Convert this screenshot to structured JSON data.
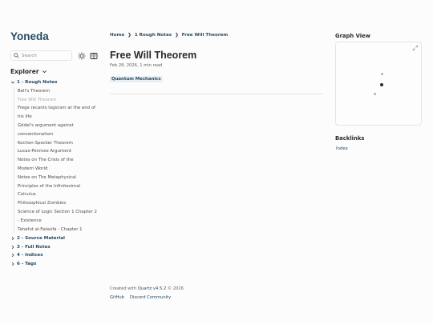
{
  "site": {
    "title": "Yoneda"
  },
  "search": {
    "placeholder": "Search"
  },
  "colors": {
    "accent": "#284b63",
    "muted": "#646464",
    "active_file": "#b3aa9f",
    "tag_bg": "#e9eff3"
  },
  "icons": {
    "search": "search-icon",
    "theme": "sun-icon",
    "reader": "book-icon",
    "chevron": "chevron-down-icon",
    "expand": "expand-icon"
  },
  "explorer": {
    "title": "Explorer",
    "folders": [
      {
        "label": "1 - Rough Notes",
        "expanded": true,
        "files": [
          {
            "label": "Bell's Theorem",
            "active": false
          },
          {
            "label": "Free Will Theorem",
            "active": true
          },
          {
            "label": "Frege recants logicism at the end of his life",
            "active": false
          },
          {
            "label": "Gödel's argument against conventionalism",
            "active": false
          },
          {
            "label": "Kochen-Specker Theorem",
            "active": false
          },
          {
            "label": "Lucas-Penrose Argument",
            "active": false
          },
          {
            "label": "Notes on The Crisis of the Modern World",
            "active": false
          },
          {
            "label": "Notes on The Metaphysical Principles of the Infinitesimal Calculus",
            "active": false
          },
          {
            "label": "Philosophical Zombies",
            "active": false
          },
          {
            "label": "Science of Logic Section 1 Chapter 2 - Existence",
            "active": false
          },
          {
            "label": "Tahafut al-Falasifa - Chapter 1",
            "active": false
          }
        ]
      },
      {
        "label": "2 - Source Material",
        "expanded": false
      },
      {
        "label": "3 - Full Notes",
        "expanded": false
      },
      {
        "label": "4 - Indices",
        "expanded": false
      },
      {
        "label": "6 - Tags",
        "expanded": false
      }
    ]
  },
  "breadcrumbs": [
    "Home",
    "1 Rough Notes",
    "Free Will Theorem"
  ],
  "breadcrumb_separator": "❯",
  "page": {
    "title": "Free Will Theorem",
    "date": "Feb 28, 2026",
    "meta_sep": ",",
    "read_time": "1 min read",
    "tags": [
      "Quantum Mechanics"
    ]
  },
  "footer": {
    "created_prefix": "Created with",
    "quartz": "Quartz v4.5.2",
    "copyright": "© 2026",
    "links": [
      "GitHub",
      "Discord Community"
    ]
  },
  "graph": {
    "title": "Graph View"
  },
  "backlinks": {
    "title": "Backlinks",
    "items": [
      "Index"
    ]
  }
}
